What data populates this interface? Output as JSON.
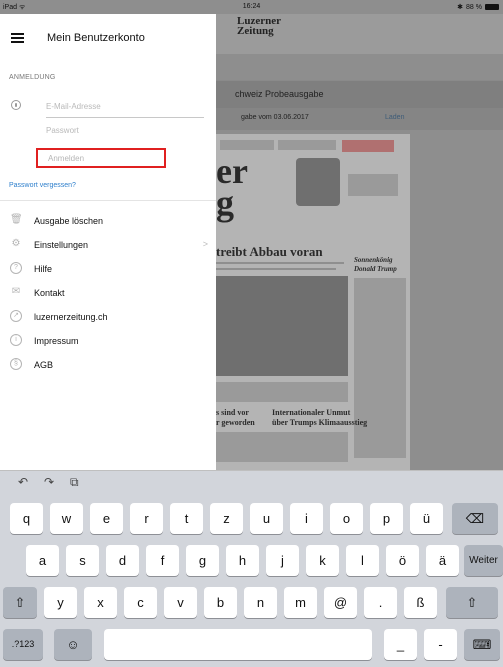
{
  "status_bar": {
    "carrier": "iPad",
    "wifi": "ᯤ",
    "time": "16:24",
    "bluetooth": "✱",
    "battery_percent": "88 %"
  },
  "background": {
    "logo_line1": "Luzerner",
    "logo_line2": "Zeitung",
    "edition_title": "chweiz Probeausgabe",
    "edition_date": "gabe vom 03.06.2017",
    "load_link": "Laden",
    "paper_headline1": "er",
    "paper_headline2": "g",
    "paper_headline3": "treibt Abbau voran",
    "paper_sub1": "s sind vor",
    "paper_sub2": "r geworden",
    "paper_sub3": "Internationaler Unmut",
    "paper_sub4": "über Trumps Klimaausstieg",
    "paper_side1": "Sonnenkönig",
    "paper_side2": "Donald Trump"
  },
  "drawer": {
    "title": "Mein Benutzerkonto",
    "section_label": "ANMELDUNG",
    "email_value": "",
    "email_placeholder": "E-Mail-Adresse",
    "password_value": "",
    "password_placeholder": "Passwort",
    "login_label": "Anmelden",
    "forgot_label": "Passwort vergessen?",
    "menu": [
      {
        "icon": "trash-icon",
        "glyph": "🗑",
        "label": "Ausgabe löschen"
      },
      {
        "icon": "settings-icon",
        "glyph": "⚙",
        "label": "Einstellungen",
        "chevron": ">"
      },
      {
        "icon": "help-icon",
        "glyph": "?",
        "label": "Hilfe"
      },
      {
        "icon": "mail-icon",
        "glyph": "✉",
        "label": "Kontakt"
      },
      {
        "icon": "compass-icon",
        "glyph": "↗",
        "label": "luzernerzeitung.ch"
      },
      {
        "icon": "info-icon",
        "glyph": "i",
        "label": "Impressum"
      },
      {
        "icon": "paragraph-icon",
        "glyph": "§",
        "label": "AGB"
      }
    ]
  },
  "keyboard": {
    "toolbar": {
      "undo": "↶",
      "redo": "↷",
      "paste": "⧉"
    },
    "row1": [
      "q",
      "w",
      "e",
      "r",
      "t",
      "z",
      "u",
      "i",
      "o",
      "p",
      "ü"
    ],
    "backspace": "⌫",
    "row2": [
      "a",
      "s",
      "d",
      "f",
      "g",
      "h",
      "j",
      "k",
      "l",
      "ö",
      "ä"
    ],
    "return_label": "Weiter",
    "shift": "⇧",
    "row3": [
      "y",
      "x",
      "c",
      "v",
      "b",
      "n",
      "m",
      "@",
      ".",
      "ß"
    ],
    "numbers_label": ".?123",
    "emoji": "☺",
    "space": "",
    "underscore": "_",
    "dash": "-",
    "hide": "⌨"
  }
}
